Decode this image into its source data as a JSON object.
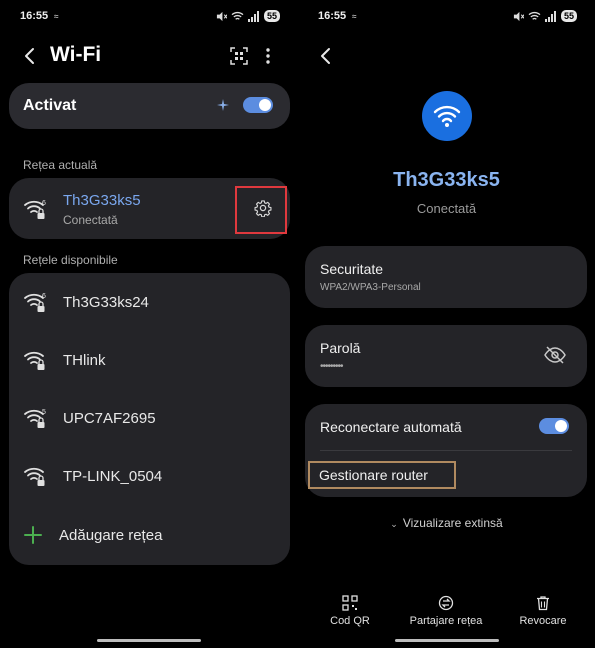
{
  "left": {
    "status": {
      "time": "16:55",
      "battery": "55"
    },
    "title": "Wi-Fi",
    "master_toggle": {
      "label": "Activat",
      "on": true
    },
    "current_section": "Rețea actuală",
    "current_network": {
      "name": "Th3G33ks5",
      "status": "Conectată"
    },
    "available_section": "Rețele disponibile",
    "networks": [
      {
        "name": "Th3G33ks24",
        "badge": "6"
      },
      {
        "name": "THlink",
        "badge": ""
      },
      {
        "name": "UPC7AF2695",
        "badge": "5"
      },
      {
        "name": "TP-LINK_0504",
        "badge": ""
      }
    ],
    "add_network": "Adăugare rețea",
    "highlight_color": "#e0393e",
    "accent": "#5c8de0"
  },
  "right": {
    "status": {
      "time": "16:55",
      "battery": "55"
    },
    "network_name": "Th3G33ks5",
    "network_status": "Conectată",
    "security": {
      "label": "Securitate",
      "value": "WPA2/WPA3-Personal"
    },
    "password": {
      "label": "Parolă",
      "value": "•••••••••"
    },
    "auto_reconnect": {
      "label": "Reconectare automată",
      "on": true
    },
    "manage_router": "Gestionare router",
    "expand": "Vizualizare extinsă",
    "actions": [
      {
        "label": "Cod QR",
        "icon": "qr-code-icon"
      },
      {
        "label": "Partajare rețea",
        "icon": "share-icon"
      },
      {
        "label": "Revocare",
        "icon": "trash-icon"
      }
    ],
    "highlight_color": "#b08a60",
    "wifi_circle_color": "#1a6fe0"
  }
}
